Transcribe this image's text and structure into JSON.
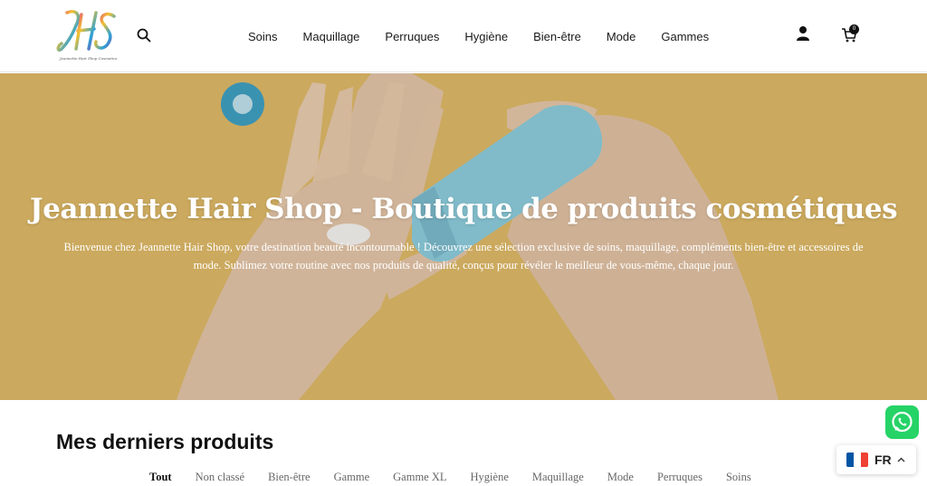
{
  "header": {
    "logo_text": "JHS",
    "logo_tagline": "Jeannette Hair Shop Cosmetics",
    "nav": [
      {
        "label": "Soins"
      },
      {
        "label": "Maquillage"
      },
      {
        "label": "Perruques"
      },
      {
        "label": "Hygiène"
      },
      {
        "label": "Bien-être"
      },
      {
        "label": "Mode"
      },
      {
        "label": "Gammes"
      }
    ],
    "cart_count": "0",
    "icons": {
      "search": "search-icon",
      "account": "user-icon",
      "cart": "cart-icon"
    }
  },
  "hero": {
    "title": "Jeannette Hair Shop - Boutique de produits cosmétiques",
    "description": "Bienvenue chez Jeannette Hair Shop, votre destination beauté incontournable ! Découvrez une sélection exclusive de soins, maquillage, compléments bien-être et accessoires de mode. Sublimez votre routine avec nos produits de qualité, conçus pour révéler le meilleur de vous-même, chaque jour."
  },
  "products": {
    "title": "Mes derniers produits",
    "filters": [
      {
        "label": "Tout",
        "active": true
      },
      {
        "label": "Non classé"
      },
      {
        "label": "Bien-être"
      },
      {
        "label": "Gamme"
      },
      {
        "label": "Gamme XL"
      },
      {
        "label": "Hygiène"
      },
      {
        "label": "Maquillage"
      },
      {
        "label": "Mode"
      },
      {
        "label": "Perruques"
      },
      {
        "label": "Soins"
      }
    ]
  },
  "widgets": {
    "whatsapp_icon": "whatsapp-icon",
    "language": "FR",
    "flag_colors": [
      "#0055a4",
      "#ffffff",
      "#ef4135"
    ]
  },
  "colors": {
    "hero_background": "#ddb867",
    "whatsapp_green": "#25d366"
  }
}
